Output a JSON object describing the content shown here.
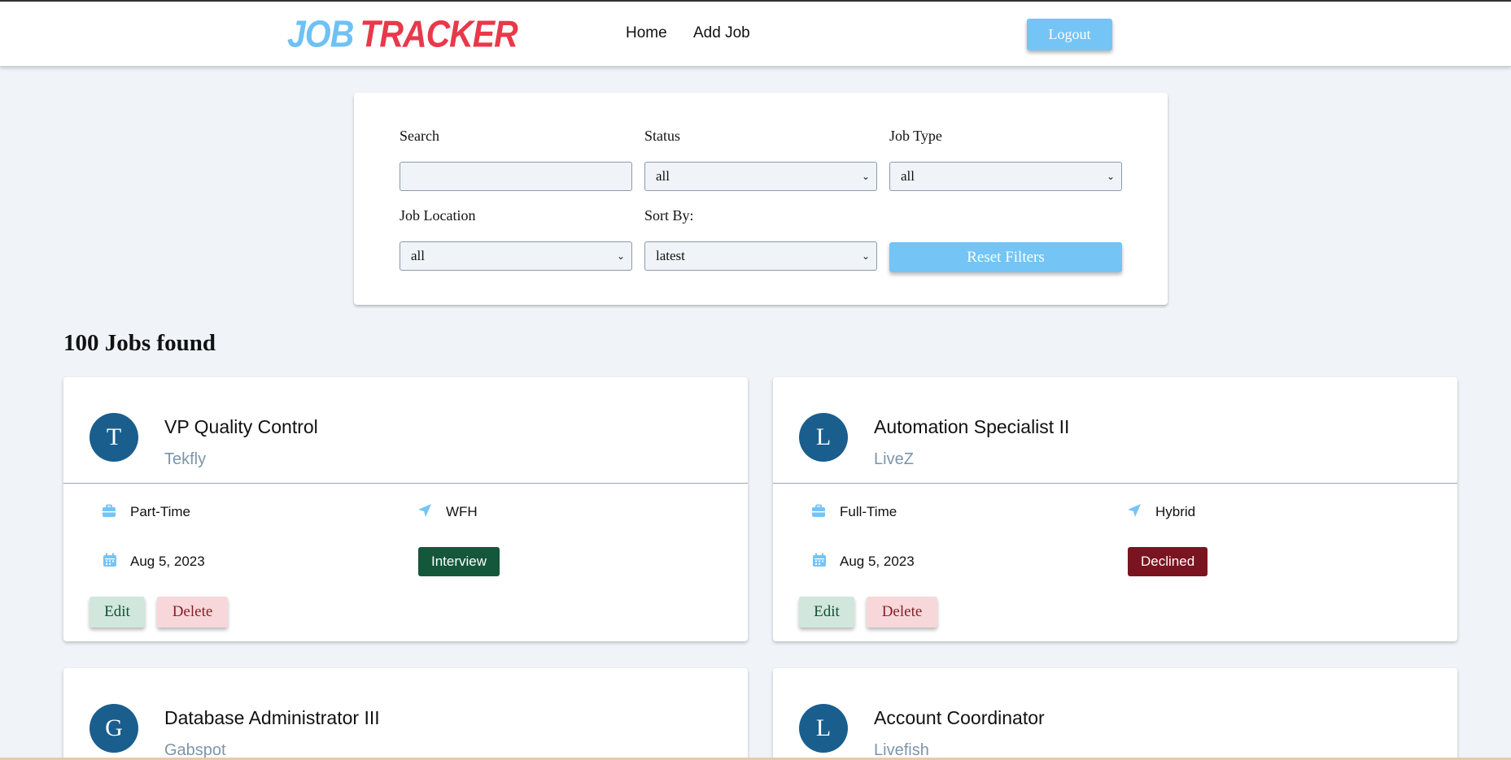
{
  "navbar": {
    "logo_part1": "JOB",
    "logo_part2": "TRACKER",
    "links": [
      {
        "label": "Home"
      },
      {
        "label": "Add Job"
      }
    ],
    "logout_label": "Logout"
  },
  "filters": {
    "search": {
      "label": "Search",
      "value": ""
    },
    "status": {
      "label": "Status",
      "value": "all"
    },
    "job_type": {
      "label": "Job Type",
      "value": "all"
    },
    "job_location": {
      "label": "Job Location",
      "value": "all"
    },
    "sort_by": {
      "label": "Sort By:",
      "value": "latest"
    },
    "reset_label": "Reset Filters"
  },
  "jobs_found": "100 Jobs found",
  "jobs": [
    {
      "initial": "T",
      "title": "VP Quality Control",
      "company": "Tekfly",
      "type": "Part-Time",
      "location": "WFH",
      "date": "Aug 5, 2023",
      "status": "Interview",
      "status_color": "#14573b",
      "edit_label": "Edit",
      "delete_label": "Delete"
    },
    {
      "initial": "L",
      "title": "Automation Specialist II",
      "company": "LiveZ",
      "type": "Full-Time",
      "location": "Hybrid",
      "date": "Aug 5, 2023",
      "status": "Declined",
      "status_color": "#7a1420",
      "edit_label": "Edit",
      "delete_label": "Delete"
    },
    {
      "initial": "G",
      "title": "Database Administrator III",
      "company": "Gabspot"
    },
    {
      "initial": "L",
      "title": "Account Coordinator",
      "company": "Livefish"
    }
  ],
  "colors": {
    "primary": "#74c4f6",
    "avatar": "#1a5e8e",
    "background": "#f0f4f8"
  }
}
